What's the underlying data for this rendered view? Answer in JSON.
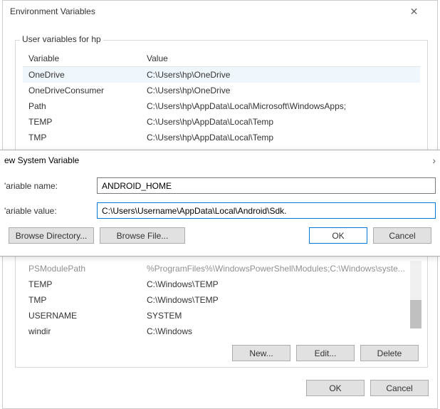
{
  "mainWindow": {
    "title": "Environment Variables",
    "close": "✕"
  },
  "userVars": {
    "groupLabel": "User variables for hp",
    "headers": {
      "variable": "Variable",
      "value": "Value"
    },
    "rows": [
      {
        "var": "OneDrive",
        "val": "C:\\Users\\hp\\OneDrive"
      },
      {
        "var": "OneDriveConsumer",
        "val": "C:\\Users\\hp\\OneDrive"
      },
      {
        "var": "Path",
        "val": "C:\\Users\\hp\\AppData\\Local\\Microsoft\\WindowsApps;"
      },
      {
        "var": "TEMP",
        "val": "C:\\Users\\hp\\AppData\\Local\\Temp"
      },
      {
        "var": "TMP",
        "val": "C:\\Users\\hp\\AppData\\Local\\Temp"
      }
    ]
  },
  "dialog": {
    "title": "ew System Variable",
    "nameLabel": "'ariable name:",
    "valueLabel": "'ariable value:",
    "nameInput": "ANDROID_HOME",
    "valueInput": "C:\\Users\\Username\\AppData\\Local\\Android\\Sdk.",
    "browseDirectory": "Browse Directory...",
    "browseFile": "Browse File...",
    "ok": "OK",
    "cancel": "Cancel"
  },
  "sysVars": {
    "rows": [
      {
        "var": "PSModulePath",
        "val": "%ProgramFiles%\\WindowsPowerShell\\Modules;C:\\Windows\\syste..."
      },
      {
        "var": "TEMP",
        "val": "C:\\Windows\\TEMP"
      },
      {
        "var": "TMP",
        "val": "C:\\Windows\\TEMP"
      },
      {
        "var": "USERNAME",
        "val": "SYSTEM"
      },
      {
        "var": "windir",
        "val": "C:\\Windows"
      }
    ],
    "new": "New...",
    "edit": "Edit...",
    "delete": "Delete"
  },
  "bottom": {
    "ok": "OK",
    "cancel": "Cancel"
  }
}
